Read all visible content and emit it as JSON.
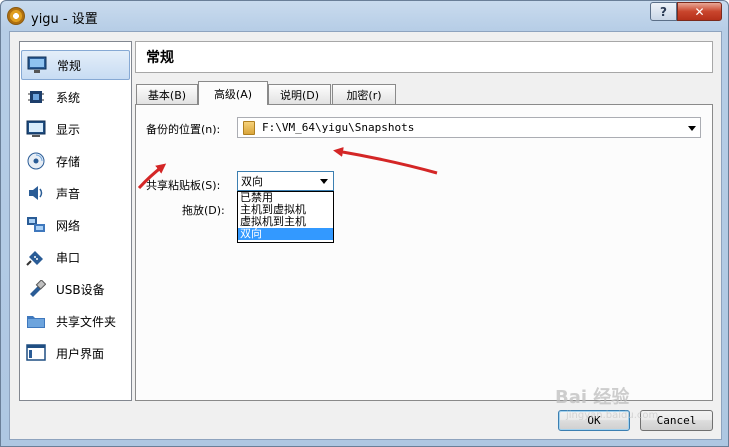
{
  "window": {
    "title": "yigu - 设置",
    "help_label": "?",
    "close_label": "✕"
  },
  "sidebar": {
    "items": [
      {
        "label": "常规",
        "icon": "monitor-icon"
      },
      {
        "label": "系统",
        "icon": "chip-icon"
      },
      {
        "label": "显示",
        "icon": "display-icon"
      },
      {
        "label": "存储",
        "icon": "disk-icon"
      },
      {
        "label": "声音",
        "icon": "speaker-icon"
      },
      {
        "label": "网络",
        "icon": "network-icon"
      },
      {
        "label": "串口",
        "icon": "serial-port-icon"
      },
      {
        "label": "USB设备",
        "icon": "usb-icon"
      },
      {
        "label": "共享文件夹",
        "icon": "folder-icon"
      },
      {
        "label": "用户界面",
        "icon": "window-icon"
      }
    ],
    "selected_index": 0
  },
  "header": {
    "title": "常规"
  },
  "tabs": [
    {
      "label": "基本(B)"
    },
    {
      "label": "高级(A)"
    },
    {
      "label": "说明(D)"
    },
    {
      "label": "加密(r)"
    }
  ],
  "active_tab": 1,
  "advanced": {
    "snapshot_label": "备份的位置(n):",
    "snapshot_path": "F:\\VM_64\\yigu\\Snapshots",
    "clipboard_label": "共享粘贴板(S):",
    "clipboard_value": "双向",
    "dragdrop_label": "拖放(D):",
    "clipboard_options": [
      "已禁用",
      "主机到虚拟机",
      "虚拟机到主机",
      "双向"
    ],
    "clipboard_selected_index": 3
  },
  "buttons": {
    "ok": "OK",
    "cancel": "Cancel"
  },
  "annotation_color": "#d42626",
  "watermark": {
    "text": "Bai 经验",
    "sub": "jingyan.baidu.com"
  }
}
